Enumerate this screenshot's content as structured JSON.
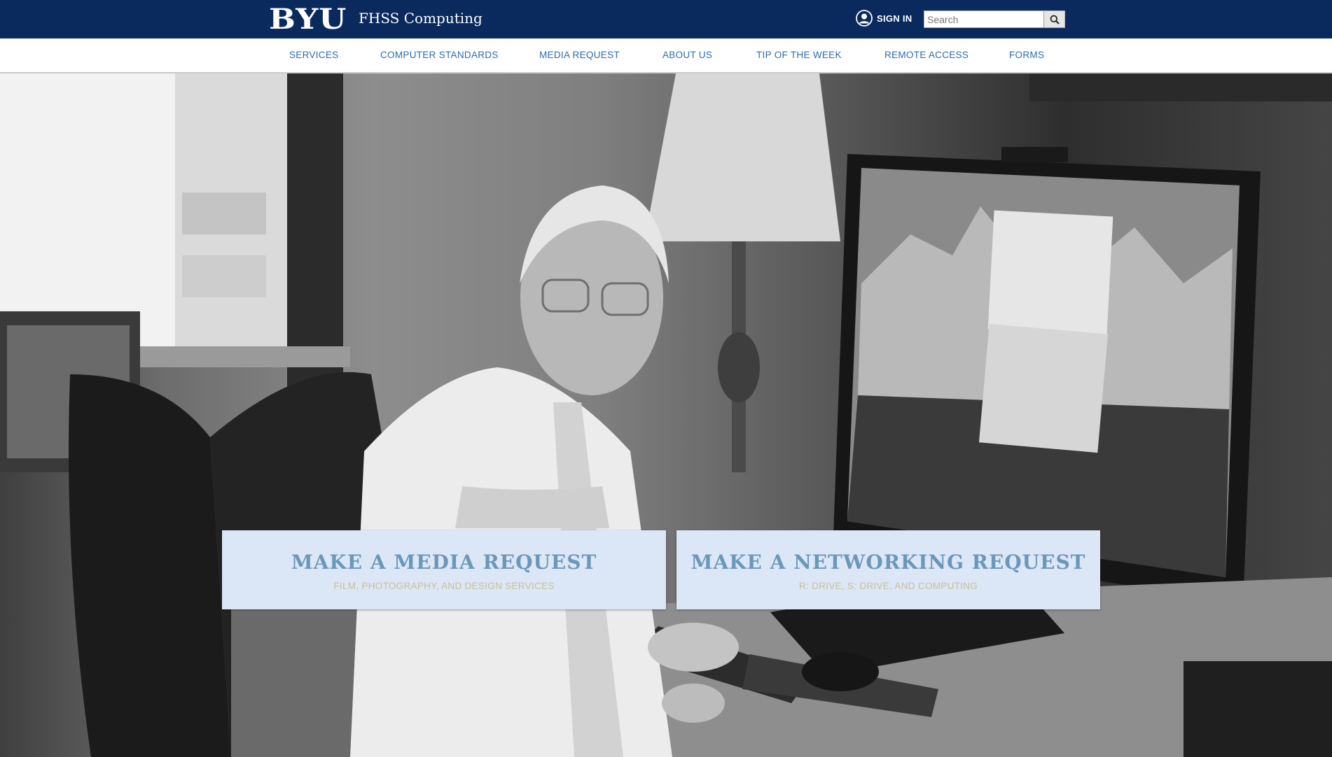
{
  "header": {
    "logo": "BYU",
    "site_title": "FHSS Computing",
    "sign_in_label": "SIGN IN",
    "search_placeholder": "Search",
    "icons": {
      "account": "user-circle-icon",
      "search": "magnifier-icon"
    }
  },
  "nav": {
    "items": [
      {
        "label": "SERVICES"
      },
      {
        "label": "COMPUTER STANDARDS"
      },
      {
        "label": "MEDIA REQUEST"
      },
      {
        "label": "ABOUT US"
      },
      {
        "label": "TIP OF THE WEEK"
      },
      {
        "label": "REMOTE ACCESS"
      },
      {
        "label": "FORMS"
      }
    ]
  },
  "hero": {
    "cards": [
      {
        "title": "MAKE A MEDIA REQUEST",
        "subtitle": "FILM, PHOTOGRAPHY, AND DESIGN SERVICES"
      },
      {
        "title": "MAKE A NETWORKING REQUEST",
        "subtitle": "R: DRIVE, S: DRIVE, AND COMPUTING"
      }
    ]
  },
  "colors": {
    "header_bg": "#0a2a5e",
    "nav_link": "#2c6bb0",
    "card_bg": "#dbe7f7",
    "card_title": "#6b97b9",
    "card_subtitle": "#c8bf97"
  }
}
